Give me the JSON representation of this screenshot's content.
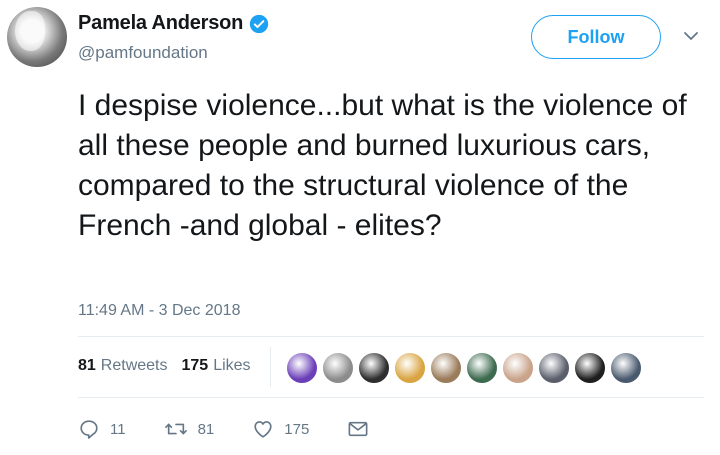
{
  "user": {
    "display_name": "Pamela Anderson",
    "handle": "@pamfoundation",
    "verified": true,
    "avatar_icon": "profile-photo"
  },
  "header": {
    "follow_label": "Follow",
    "menu_icon": "chevron-down-icon"
  },
  "tweet": {
    "text": "I despise violence...but what is the violence of all these people and burned luxurious cars, compared to the structural violence of the French -and global - elites?",
    "timestamp": "11:49 AM - 3 Dec 2018"
  },
  "stats": {
    "retweets_count": "81",
    "retweets_label": "Retweets",
    "likes_count": "175",
    "likes_label": "Likes"
  },
  "likers": {
    "colors": [
      "#6a3fb8",
      "#8c8c8c",
      "#2e2e2e",
      "#d9a441",
      "#9a7b5a",
      "#3d6b4f",
      "#c9a38a",
      "#5a5f6b",
      "#1f1f1f",
      "#4a5a6e"
    ]
  },
  "actions": {
    "reply_count": "11",
    "retweet_count": "81",
    "like_count": "175"
  },
  "colors": {
    "accent": "#1da1f2",
    "text_primary": "#14171a",
    "text_secondary": "#657786",
    "divider": "#e6ecf0"
  }
}
